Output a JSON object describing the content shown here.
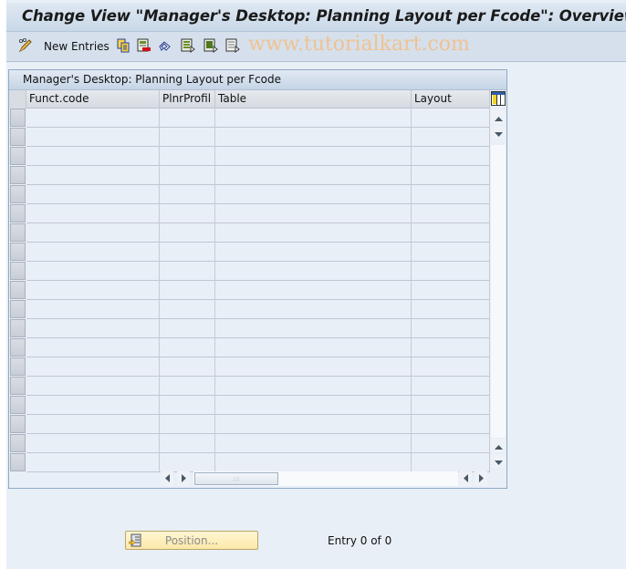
{
  "window": {
    "title": "Change View \"Manager's Desktop: Planning Layout per Fcode\": Overview"
  },
  "toolbar": {
    "items": [
      {
        "icon": "pencil-glasses-icon",
        "label": ""
      },
      {
        "icon": "new-entries",
        "label": "New Entries"
      },
      {
        "icon": "copy-icon",
        "label": ""
      },
      {
        "icon": "delete-row-icon",
        "label": ""
      },
      {
        "icon": "undo-change-icon",
        "label": ""
      },
      {
        "icon": "select-all-icon",
        "label": ""
      },
      {
        "icon": "select-block-icon",
        "label": ""
      },
      {
        "icon": "deselect-all-icon",
        "label": ""
      }
    ],
    "watermark": "www.tutorialkart.com"
  },
  "table": {
    "title": "Manager's Desktop: Planning Layout per Fcode",
    "columns": [
      "Funct.code",
      "PlnrProfil",
      "Table",
      "Layout"
    ],
    "rows": [
      [
        "",
        "",
        "",
        ""
      ],
      [
        "",
        "",
        "",
        ""
      ],
      [
        "",
        "",
        "",
        ""
      ],
      [
        "",
        "",
        "",
        ""
      ],
      [
        "",
        "",
        "",
        ""
      ],
      [
        "",
        "",
        "",
        ""
      ],
      [
        "",
        "",
        "",
        ""
      ],
      [
        "",
        "",
        "",
        ""
      ],
      [
        "",
        "",
        "",
        ""
      ],
      [
        "",
        "",
        "",
        ""
      ],
      [
        "",
        "",
        "",
        ""
      ],
      [
        "",
        "",
        "",
        ""
      ],
      [
        "",
        "",
        "",
        ""
      ],
      [
        "",
        "",
        "",
        ""
      ],
      [
        "",
        "",
        "",
        ""
      ],
      [
        "",
        "",
        "",
        ""
      ],
      [
        "",
        "",
        "",
        ""
      ],
      [
        "",
        "",
        "",
        ""
      ],
      [
        "",
        "",
        "",
        ""
      ]
    ],
    "hscroll_grip": ":::"
  },
  "footer": {
    "position_button": "Position...",
    "entry_info": "Entry 0 of 0"
  }
}
